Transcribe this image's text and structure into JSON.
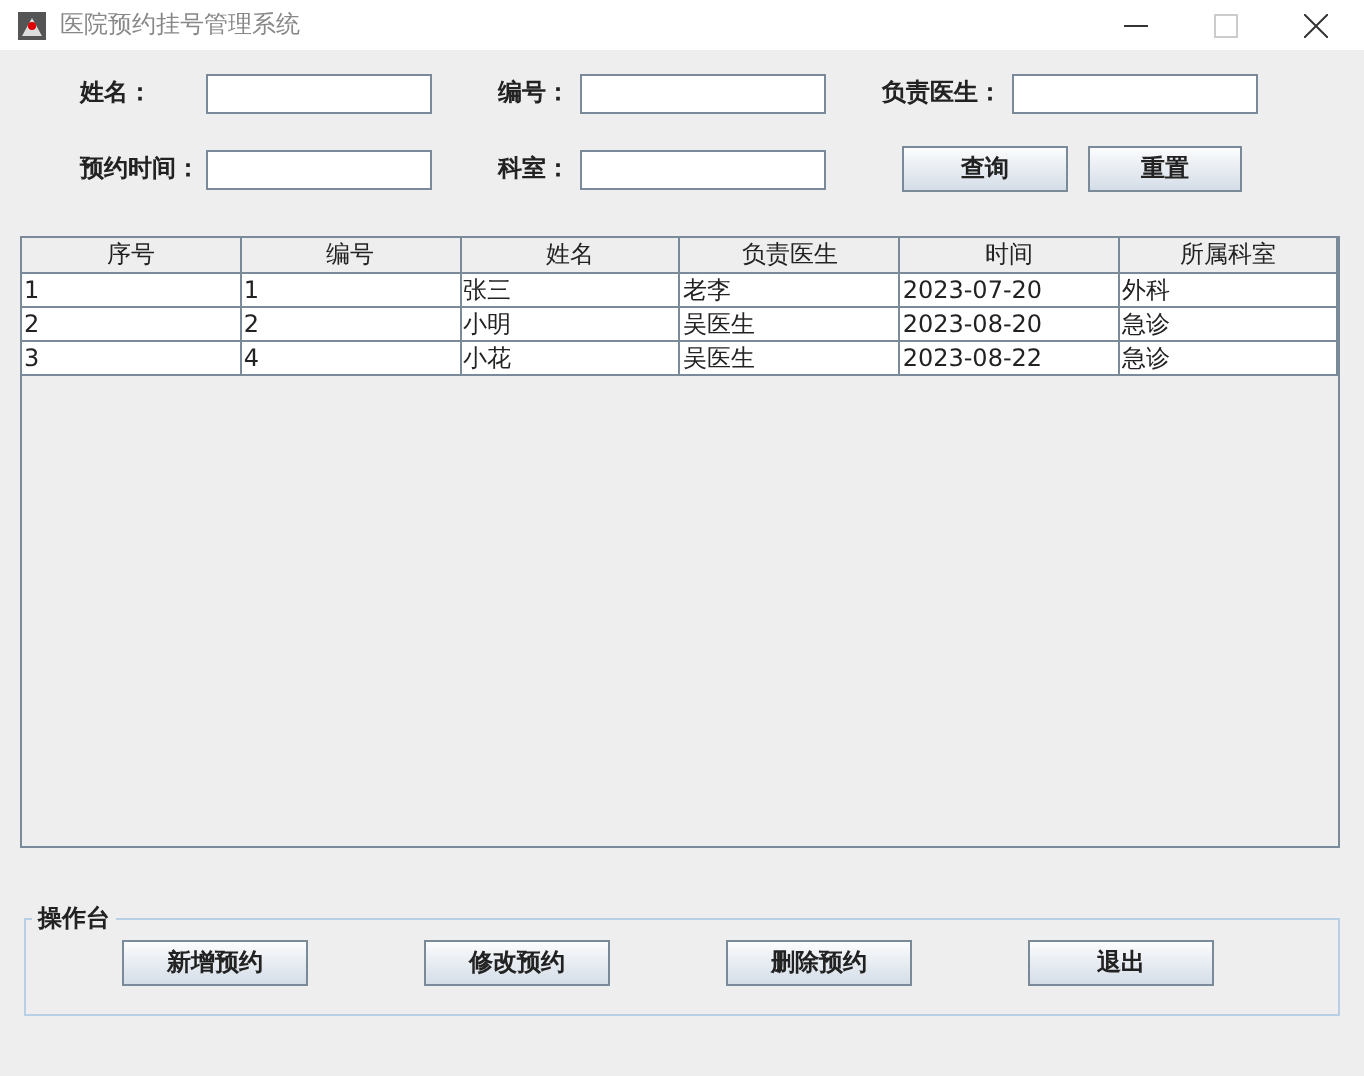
{
  "window": {
    "title": "医院预约挂号管理系统"
  },
  "search_form": {
    "fields": [
      {
        "label": "姓名："
      },
      {
        "label": "编号："
      },
      {
        "label": "负责医生："
      },
      {
        "label": "预约时间："
      },
      {
        "label": "科室："
      }
    ],
    "buttons": [
      "查询",
      "重置"
    ]
  },
  "table": {
    "columns": [
      "序号",
      "编号",
      "姓名",
      "负责医生",
      "时间",
      "所属科室"
    ],
    "rows": [
      [
        "1",
        "1",
        "张三",
        "老李",
        "2023-07-20",
        "外科"
      ],
      [
        "2",
        "2",
        "小明",
        "吴医生",
        "2023-08-20",
        "急诊"
      ],
      [
        "3",
        "4",
        "小花",
        "吴医生",
        "2023-08-22",
        "急诊"
      ]
    ]
  },
  "operations": {
    "title": "操作台",
    "buttons": [
      "新增预约",
      "修改预约",
      "删除预约",
      "退出"
    ]
  }
}
